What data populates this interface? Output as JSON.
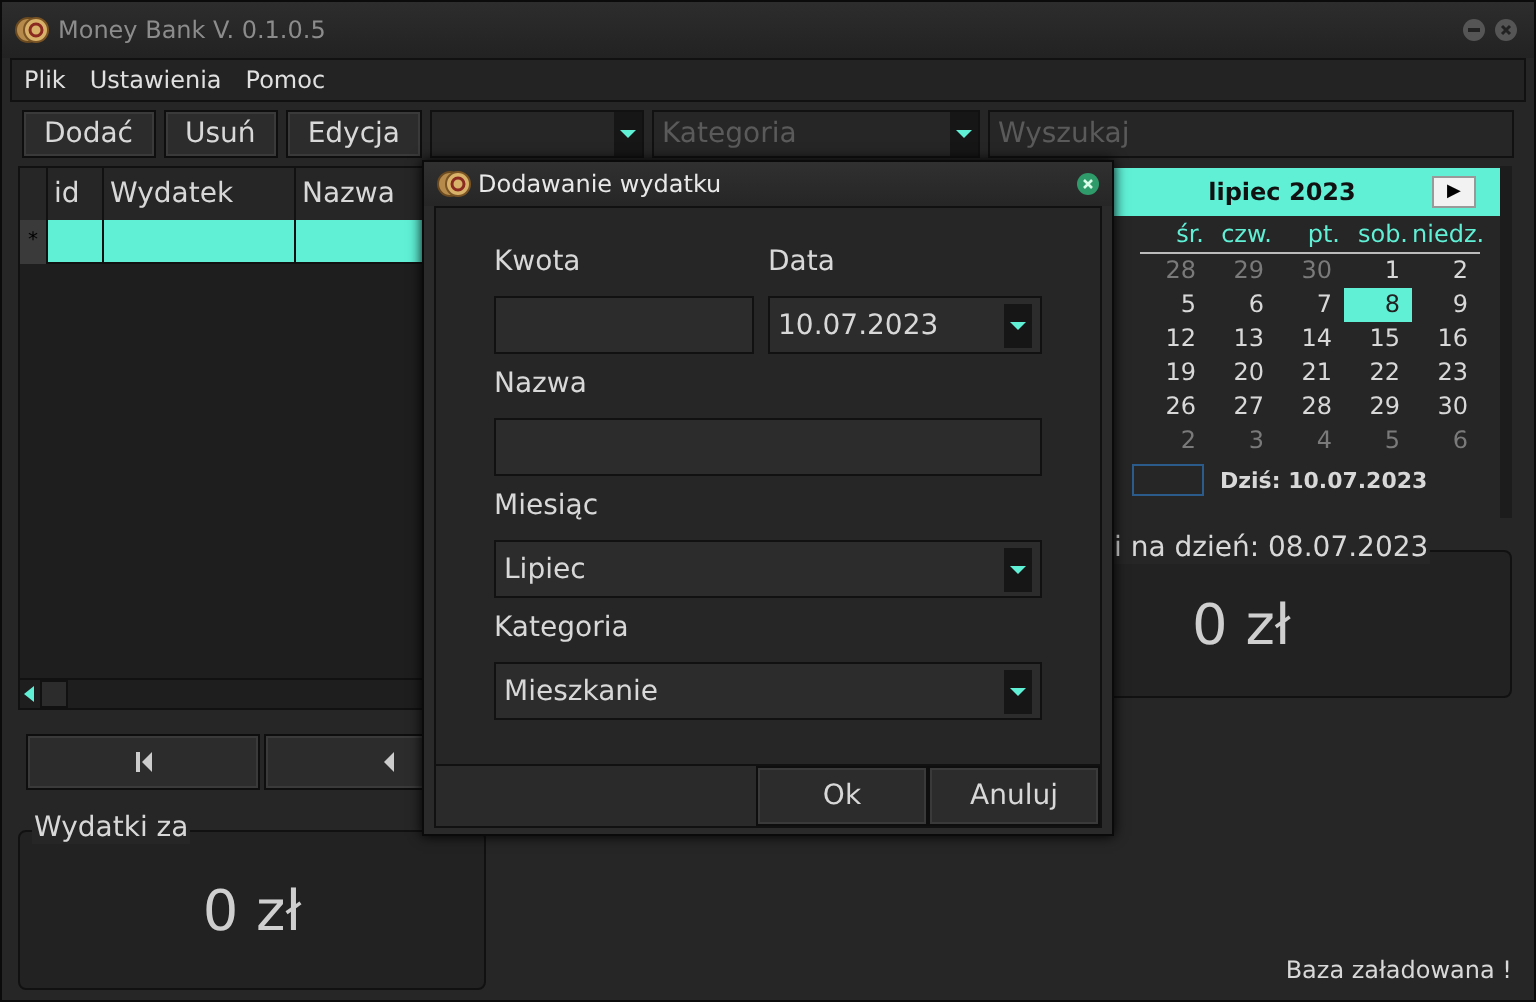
{
  "window": {
    "title": "Money Bank V. 0.1.0.5"
  },
  "menu": [
    "Plik",
    "Ustawienia",
    "Pomoc"
  ],
  "toolbar": {
    "buttons": [
      "Dodać",
      "Usuń",
      "Edycja"
    ],
    "category_combo": {
      "placeholder": "Kategoria"
    },
    "search": {
      "placeholder": "Wyszukaj"
    }
  },
  "table": {
    "columns": [
      "id",
      "Wydatek",
      "Nazwa"
    ],
    "rows": [
      {
        "marker": "*",
        "selected": true
      }
    ]
  },
  "expenses_box": {
    "legend": "Wydatki za",
    "amount": "0 zł"
  },
  "calendar": {
    "month": "lipiec 2023",
    "next": "▶",
    "weekdays": [
      "śr.",
      "czw.",
      "pt.",
      "sob.",
      "niedz."
    ],
    "weeks": [
      [
        {
          "day": "28",
          "other_month": true,
          "selected": false
        },
        {
          "day": "29",
          "other_month": true,
          "selected": false
        },
        {
          "day": "30",
          "other_month": true,
          "selected": false
        },
        {
          "day": "1",
          "other_month": false,
          "selected": false
        },
        {
          "day": "2",
          "other_month": false,
          "selected": false
        }
      ],
      [
        {
          "day": "5",
          "other_month": false,
          "selected": false
        },
        {
          "day": "6",
          "other_month": false,
          "selected": false
        },
        {
          "day": "7",
          "other_month": false,
          "selected": false
        },
        {
          "day": "8",
          "other_month": false,
          "selected": true
        },
        {
          "day": "9",
          "other_month": false,
          "selected": false
        }
      ],
      [
        {
          "day": "12",
          "other_month": false,
          "selected": false
        },
        {
          "day": "13",
          "other_month": false,
          "selected": false
        },
        {
          "day": "14",
          "other_month": false,
          "selected": false
        },
        {
          "day": "15",
          "other_month": false,
          "selected": false
        },
        {
          "day": "16",
          "other_month": false,
          "selected": false
        }
      ],
      [
        {
          "day": "19",
          "other_month": false,
          "selected": false
        },
        {
          "day": "20",
          "other_month": false,
          "selected": false
        },
        {
          "day": "21",
          "other_month": false,
          "selected": false
        },
        {
          "day": "22",
          "other_month": false,
          "selected": false
        },
        {
          "day": "23",
          "other_month": false,
          "selected": false
        }
      ],
      [
        {
          "day": "26",
          "other_month": false,
          "selected": false
        },
        {
          "day": "27",
          "other_month": false,
          "selected": false
        },
        {
          "day": "28",
          "other_month": false,
          "selected": false
        },
        {
          "day": "29",
          "other_month": false,
          "selected": false
        },
        {
          "day": "30",
          "other_month": false,
          "selected": false
        }
      ],
      [
        {
          "day": "2",
          "other_month": true,
          "selected": false
        },
        {
          "day": "3",
          "other_month": true,
          "selected": false
        },
        {
          "day": "4",
          "other_month": true,
          "selected": false
        },
        {
          "day": "5",
          "other_month": true,
          "selected": false
        },
        {
          "day": "6",
          "other_month": true,
          "selected": false
        }
      ]
    ],
    "today": "Dziś: 10.07.2023"
  },
  "balance_box": {
    "legend": "i na dzień:  08.07.2023",
    "amount": "0 zł"
  },
  "status": "Baza załadowana !",
  "dialog": {
    "title": "Dodawanie wydatku",
    "rows": [
      [
        {
          "label": "Kwota",
          "kind": "input"
        },
        {
          "label": "Data",
          "kind": "date",
          "value": "10.07.2023"
        }
      ],
      [
        {
          "label": "Nazwa",
          "kind": "input"
        }
      ],
      [
        {
          "label": "Miesiąc",
          "kind": "combo",
          "value": "Lipiec"
        }
      ],
      [
        {
          "label": "Kategoria",
          "kind": "combo",
          "value": "Mieszkanie"
        }
      ]
    ],
    "buttons": [
      "Ok",
      "Anuluj"
    ]
  }
}
